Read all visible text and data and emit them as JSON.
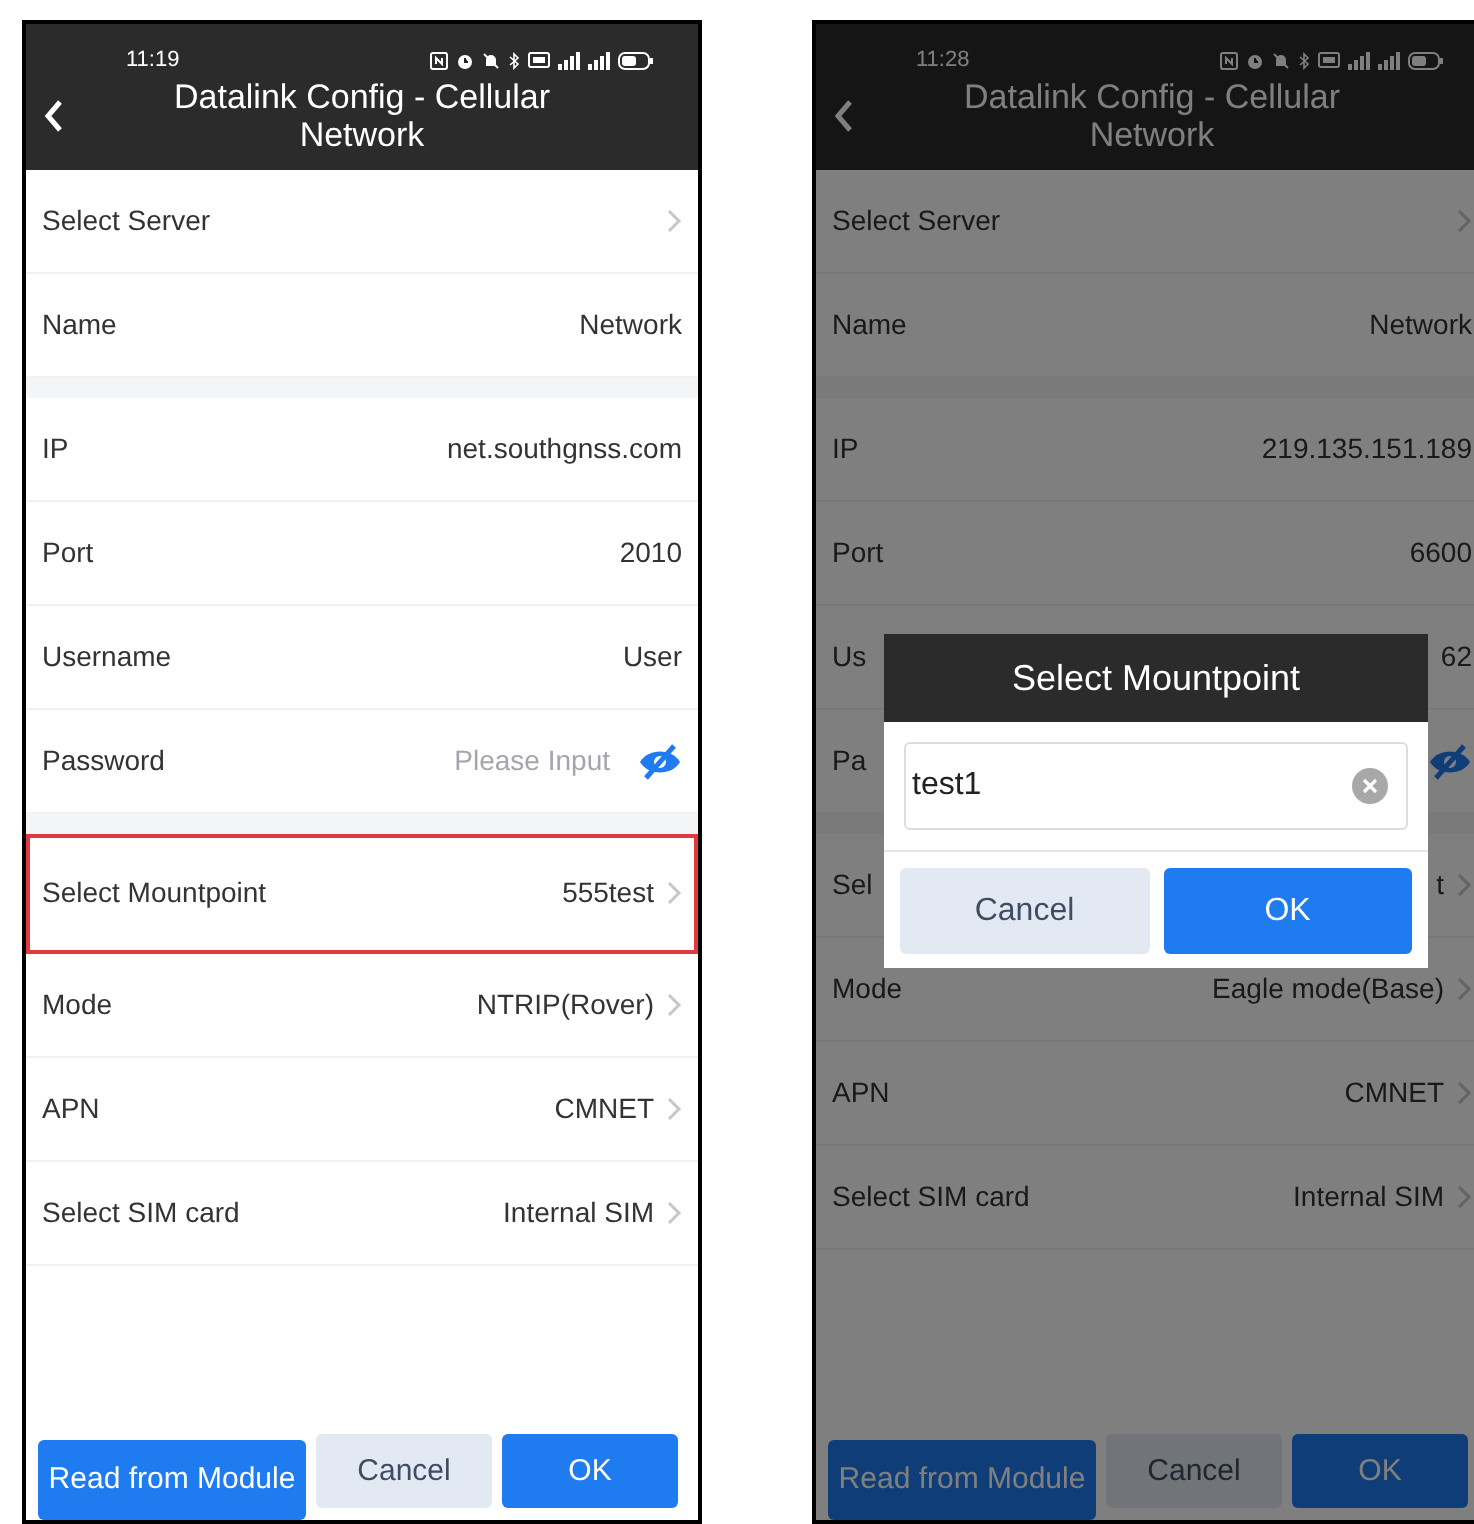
{
  "phones": [
    {
      "status": {
        "time": "11:19"
      },
      "header": {
        "title": "Datalink Config - Cellular Network"
      },
      "sections": [
        [
          {
            "label": "Select Server",
            "kind": "nav",
            "highlighted": false
          },
          {
            "label": "Name",
            "value": "Network",
            "kind": "text",
            "highlighted": false
          }
        ],
        [
          {
            "label": "IP",
            "value": "net.southgnss.com",
            "kind": "text",
            "highlighted": false
          },
          {
            "label": "Port",
            "value": "2010",
            "kind": "text",
            "highlighted": false
          },
          {
            "label": "Username",
            "value": "User",
            "kind": "text",
            "highlighted": false
          },
          {
            "label": "Password",
            "placeholder": "Please Input",
            "kind": "password",
            "highlighted": false
          }
        ],
        [
          {
            "label": "Select Mountpoint",
            "value": "555test",
            "kind": "nav",
            "highlighted": true
          },
          {
            "label": "Mode",
            "value": "NTRIP(Rover)",
            "kind": "nav",
            "highlighted": false
          },
          {
            "label": "APN",
            "value": "CMNET",
            "kind": "nav",
            "highlighted": false
          },
          {
            "label": "Select SIM card",
            "value": "Internal SIM",
            "kind": "nav",
            "highlighted": false
          }
        ]
      ],
      "buttons": [
        {
          "label": "Read from Module",
          "kind": "primary"
        },
        {
          "label": "Cancel",
          "kind": "disabled"
        },
        {
          "label": "OK",
          "kind": "primary"
        }
      ]
    },
    {
      "status": {
        "time": "11:28"
      },
      "header": {
        "title": "Datalink Config - Cellular Network"
      },
      "sections": [
        [
          {
            "label": "Select Server",
            "kind": "nav",
            "highlighted": false
          },
          {
            "label": "Name",
            "value": "Network",
            "kind": "text",
            "highlighted": false
          }
        ],
        [
          {
            "label": "IP",
            "value": "219.135.151.189",
            "kind": "text",
            "highlighted": false
          },
          {
            "label": "Port",
            "value": "6600",
            "kind": "text",
            "highlighted": false
          },
          {
            "label": "Us",
            "value": "62",
            "kind": "text",
            "highlighted": false
          },
          {
            "label": "Pa",
            "kind": "password",
            "highlighted": false
          }
        ],
        [
          {
            "label": "Sel",
            "value": "t",
            "kind": "nav",
            "highlighted": false
          },
          {
            "label": "Mode",
            "value": "Eagle mode(Base)",
            "kind": "nav",
            "highlighted": false
          },
          {
            "label": "APN",
            "value": "CMNET",
            "kind": "nav",
            "highlighted": false
          },
          {
            "label": "Select SIM card",
            "value": "Internal SIM",
            "kind": "nav",
            "highlighted": false
          }
        ]
      ],
      "buttons": [
        {
          "label": "Read from Module",
          "kind": "primary"
        },
        {
          "label": "Cancel",
          "kind": "disabled"
        },
        {
          "label": "OK",
          "kind": "primary"
        }
      ],
      "dialog": {
        "title": "Select Mountpoint",
        "value": "test1",
        "buttons": [
          {
            "label": "Cancel",
            "kind": "disabled"
          },
          {
            "label": "OK",
            "kind": "primary"
          }
        ]
      }
    }
  ]
}
